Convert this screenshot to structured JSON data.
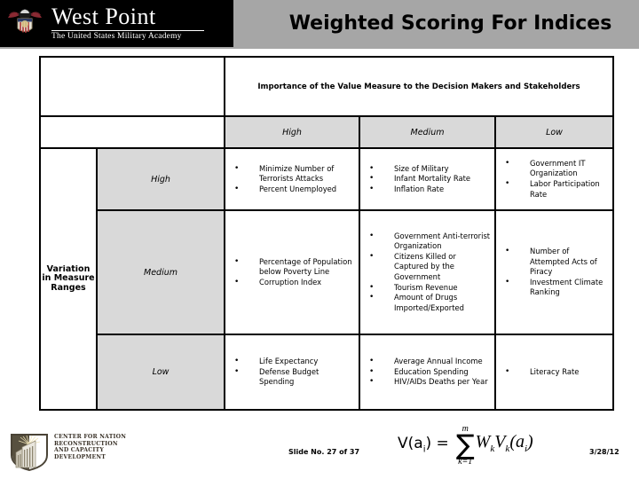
{
  "banner": {
    "institution_name": "West Point",
    "institution_sub": "The United States Military Academy",
    "slide_title": "Weighted Scoring For Indices"
  },
  "matrix": {
    "column_group_header": "Importance of the Value Measure to the Decision Makers and Stakeholders",
    "row_group_header_lines": [
      "Variation",
      "in Measure",
      "Ranges"
    ],
    "column_levels": [
      "High",
      "Medium",
      "Low"
    ],
    "row_levels": [
      "High",
      "Medium",
      "Low"
    ],
    "cells": [
      [
        [
          "Minimize Number of Terrorists Attacks",
          "Percent Unemployed"
        ],
        [
          "Size of Military",
          "Infant Mortality Rate",
          "Inflation Rate"
        ],
        [
          "Government IT Organization",
          "Labor Participation Rate"
        ]
      ],
      [
        [
          "Percentage of Population below Poverty Line",
          "Corruption Index"
        ],
        [
          "Government Anti-terrorist Organization",
          "Citizens Killed or Captured by the Government",
          "Tourism Revenue",
          "Amount of Drugs Imported/Exported"
        ],
        [
          "Number of Attempted Acts of Piracy",
          "Investment Climate Ranking"
        ]
      ],
      [
        [
          "Life Expectancy",
          "Defense Budget Spending"
        ],
        [
          "Average Annual Income",
          "Education Spending",
          "HIV/AIDs Deaths per Year"
        ],
        [
          "Literacy Rate"
        ]
      ]
    ]
  },
  "footer": {
    "center_logo_lines": [
      "Center for Nation",
      "Reconstruction",
      "and Capacity",
      "Development"
    ],
    "slide_number": "Slide No. 27 of 37",
    "date": "3/28/12",
    "formula": {
      "lhs": "V(a",
      "lhs_sub": "i",
      "lhs_close": ") =",
      "sigma_upper": "m",
      "sigma_glyph": "∑",
      "sigma_lower": "k=1",
      "rhs": "W",
      "rhs_sub1": "k",
      "rhs2": "V",
      "rhs_sub2": "k",
      "rhs3": "(a",
      "rhs_sub3": "i",
      "rhs4": ")"
    }
  },
  "colors": {
    "banner_grey": "#a6a6a6",
    "logo_black": "#000000",
    "cell_grey": "#d9d9d9",
    "border": "#000000"
  }
}
